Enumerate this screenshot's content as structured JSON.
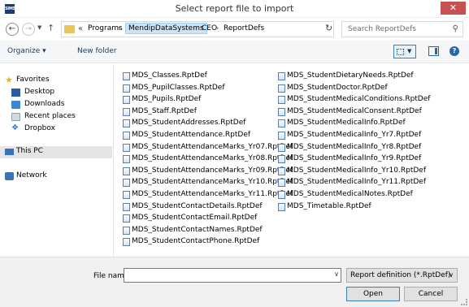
{
  "window": {
    "icon_text": "SIMS",
    "title": "Select report file to import",
    "close_label": "✕"
  },
  "address_bar": {
    "more_label": "«",
    "breadcrumb": [
      "Programs",
      "MendipDataSystems",
      "CEO",
      "ReportDefs"
    ],
    "separator": "›",
    "dropdown_icon": "chevron-down-icon",
    "refresh_icon": "refresh-icon",
    "search_placeholder": "Search ReportDefs"
  },
  "toolbar": {
    "organize_label": "Organize ▾",
    "new_folder_label": "New folder"
  },
  "nav_pane": {
    "favorites": "Favorites",
    "favorites_items": [
      "Desktop",
      "Downloads",
      "Recent places",
      "Dropbox"
    ],
    "this_pc": "This PC",
    "network": "Network"
  },
  "files": {
    "column1": [
      "MDS_Classes.RptDef",
      "MDS_PupilClasses.RptDef",
      "MDS_Pupils.RptDef",
      "MDS_Staff.RptDef",
      "MDS_StudentAddresses.RptDef",
      "MDS_StudentAttendance.RptDef",
      "MDS_StudentAttendanceMarks_Yr07.RptDef",
      "MDS_StudentAttendanceMarks_Yr08.RptDef",
      "MDS_StudentAttendanceMarks_Yr09.RptDef",
      "MDS_StudentAttendanceMarks_Yr10.RptDef",
      "MDS_StudentAttendanceMarks_Yr11.RptDef",
      "MDS_StudentContactDetails.RptDef",
      "MDS_StudentContactEmail.RptDef",
      "MDS_StudentContactNames.RptDef",
      "MDS_StudentContactPhone.RptDef"
    ],
    "column2": [
      "MDS_StudentDietaryNeeds.RptDef",
      "MDS_StudentDoctor.RptDef",
      "MDS_StudentMedicalConditions.RptDef",
      "MDS_StudentMedicalConsent.RptDef",
      "MDS_StudentMedicalInfo.RptDef",
      "MDS_StudentMedicalInfo_Yr7.RptDef",
      "MDS_StudentMedicalInfo_Yr8.RptDef",
      "MDS_StudentMedicalInfo_Yr9.RptDef",
      "MDS_StudentMedicalInfo_Yr10.RptDef",
      "MDS_StudentMedicalInfo_Yr11.RptDef",
      "MDS_StudentMedicalNotes.RptDef",
      "MDS_Timetable.RptDef"
    ]
  },
  "bottom": {
    "file_name_label": "File name:",
    "file_name_value": "",
    "filter_value": "Report definition (*.RptDef)",
    "open_label": "Open",
    "cancel_label": "Cancel"
  },
  "colors": {
    "close_button": "#c75050",
    "selected_crumb": "#cce4f7",
    "link_text": "#1e395b"
  }
}
